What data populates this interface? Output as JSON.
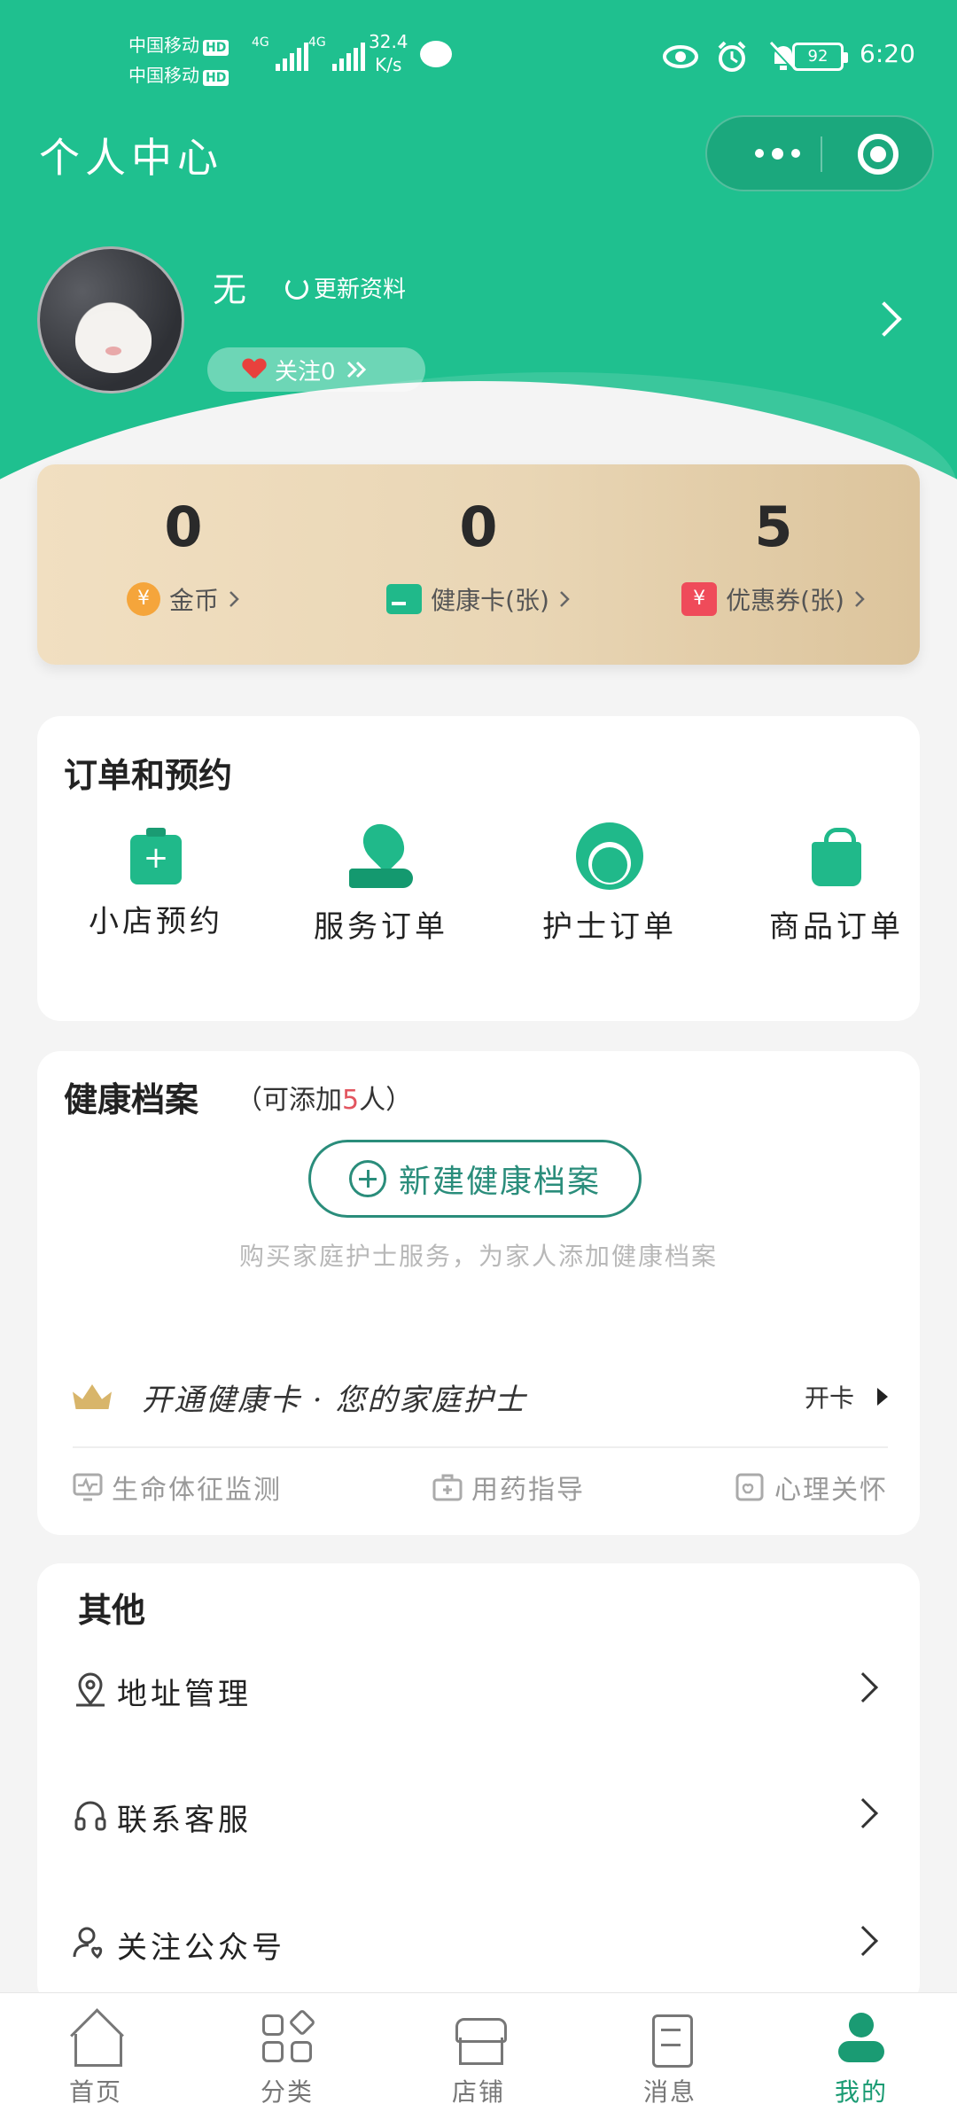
{
  "status_bar": {
    "carrier_1": "中国移动",
    "carrier_2": "中国移动",
    "hd": "HD",
    "network_1": "4G",
    "network_2": "4G",
    "speed_value": "32.4",
    "speed_unit": "K/s",
    "battery": "92",
    "time": "6:20"
  },
  "header": {
    "title": "个人中心"
  },
  "profile": {
    "name": "无",
    "update_label": "更新资料",
    "follow_label": "关注0"
  },
  "assets": {
    "items": [
      {
        "value": "0",
        "label": "金币",
        "icon": "coin-icon"
      },
      {
        "value": "0",
        "label": "健康卡(张)",
        "icon": "card-icon"
      },
      {
        "value": "5",
        "label": "优惠券(张)",
        "icon": "coupon-icon"
      }
    ],
    "coin_glyph": "¥",
    "coupon_glyph": "¥"
  },
  "orders": {
    "title": "订单和预约",
    "items": [
      {
        "label": "小店预约",
        "icon": "clipboard-icon"
      },
      {
        "label": "服务订单",
        "icon": "heart-hand-icon"
      },
      {
        "label": "护士订单",
        "icon": "nurse-icon"
      },
      {
        "label": "商品订单",
        "icon": "shopping-bag-icon"
      }
    ]
  },
  "health": {
    "title": "健康档案",
    "sub_prefix": "（可添加",
    "sub_count": "5",
    "sub_suffix": "人）",
    "new_button": "新建健康档案",
    "hint": "购买家庭护士服务，为家人添加健康档案",
    "vip_text": "开通健康卡 · 您的家庭护士",
    "vip_action": "开卡",
    "benefits": [
      "生命体征监测",
      "用药指导",
      "心理关怀"
    ]
  },
  "other": {
    "title": "其他",
    "items": [
      {
        "label": "地址管理",
        "icon": "location-pin-icon"
      },
      {
        "label": "联系客服",
        "icon": "headset-icon"
      },
      {
        "label": "关注公众号",
        "icon": "user-heart-icon"
      }
    ]
  },
  "tabbar": {
    "items": [
      {
        "label": "首页",
        "icon": "home-icon"
      },
      {
        "label": "分类",
        "icon": "category-icon"
      },
      {
        "label": "店铺",
        "icon": "store-icon"
      },
      {
        "label": "消息",
        "icon": "message-icon"
      },
      {
        "label": "我的",
        "icon": "profile-icon"
      }
    ],
    "active": "我的"
  },
  "colors": {
    "primary": "#1fc08f",
    "accent_dark": "#1a9b73",
    "outline_button": "#2a8d7b",
    "asset_card": "#e9d6b5",
    "highlight": "#e2555f"
  }
}
